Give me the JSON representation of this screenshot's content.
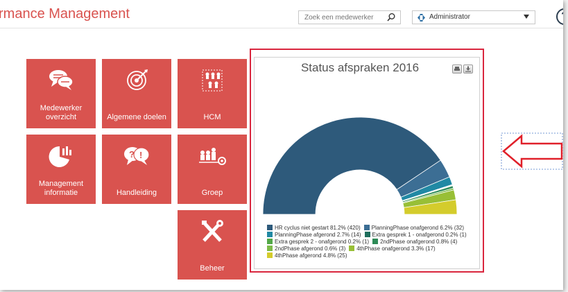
{
  "header": {
    "app_title": "rmance Management",
    "search_placeholder": "Zoek een medewerker",
    "role_value": "Administrator",
    "help_label": "?"
  },
  "tiles": [
    {
      "label": "Medewerker overzicht",
      "icon": "speech-bubbles-icon"
    },
    {
      "label": "Algemene doelen",
      "icon": "target-icon"
    },
    {
      "label": "HCM",
      "icon": "org-chart-icon"
    },
    {
      "label": "Management informatie",
      "icon": "pie-bar-chart-icon"
    },
    {
      "label": "Handleiding",
      "icon": "question-exclamation-icon"
    },
    {
      "label": "Groep",
      "icon": "group-icon"
    },
    {
      "label": "Beheer",
      "icon": "tools-icon"
    }
  ],
  "chart_data": {
    "type": "pie",
    "variant": "semi-donut",
    "title": "Status afspraken 2016",
    "series": [
      {
        "name": "HR cyclus niet gestart",
        "percent": 81.2,
        "count": 420,
        "label": "HR cyclus niet gestart 81.2% (420)",
        "color": "#2e5a7b"
      },
      {
        "name": "PlanningPhase onafgerond",
        "percent": 6.2,
        "count": 32,
        "label": "PlanningPhase onafgerond 6.2% (32)",
        "color": "#3c6e94"
      },
      {
        "name": "PlanningPhase afgerond",
        "percent": 2.7,
        "count": 14,
        "label": "PlanningPhase afgerond 2.7% (14)",
        "color": "#2189a4"
      },
      {
        "name": "Extra gesprek 1 - onafgerond",
        "percent": 0.2,
        "count": 1,
        "label": "Extra gesprek 1 - onafgerond 0.2% (1)",
        "color": "#1f6e5d"
      },
      {
        "name": "Extra gesprek 2 - onafgerond",
        "percent": 0.2,
        "count": 1,
        "label": "Extra gesprek 2 - onafgerond 0.2% (1)",
        "color": "#53a848"
      },
      {
        "name": "2ndPhase onafgerond",
        "percent": 0.8,
        "count": 4,
        "label": "2ndPhase onafgerond 0.8% (4)",
        "color": "#2e8b57"
      },
      {
        "name": "2ndPhase afgerond",
        "percent": 0.6,
        "count": 3,
        "label": "2ndPhase afgerond 0.6% (3)",
        "color": "#7dbb4a"
      },
      {
        "name": "4thPhase onafgerond",
        "percent": 3.3,
        "count": 17,
        "label": "4thPhase onafgerond 3.3% (17)",
        "color": "#98bf36"
      },
      {
        "name": "4thPhase afgerond",
        "percent": 4.8,
        "count": 25,
        "label": "4thPhase afgerond 4.8% (25)",
        "color": "#d4cc2c"
      }
    ],
    "legend_placement": "bottom"
  },
  "colors": {
    "accent": "#d9534f",
    "chart_highlight_border": "#d9263e",
    "arrow": "#e0202a"
  }
}
